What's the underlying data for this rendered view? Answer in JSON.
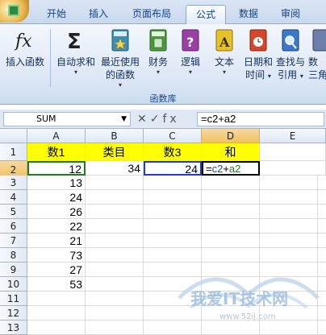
{
  "tabs": [
    "开始",
    "插入",
    "页面布局",
    "公式",
    "数据",
    "审阅"
  ],
  "ribbon": {
    "buttons": [
      {
        "label1": "插入函数",
        "label2": ""
      },
      {
        "label1": "自动求和",
        "label2": ""
      },
      {
        "label1": "最近使用",
        "label2": "的函数"
      },
      {
        "label1": "财务",
        "label2": ""
      },
      {
        "label1": "逻辑",
        "label2": ""
      },
      {
        "label1": "文本",
        "label2": ""
      },
      {
        "label1": "日期和",
        "label2": "时间"
      },
      {
        "label1": "查找与",
        "label2": "引用"
      },
      {
        "label1": "数",
        "label2": "三角"
      }
    ],
    "group_label": "函数库"
  },
  "formula_bar": {
    "name_box": "SUM",
    "tools": "✕✓fx",
    "formula": "=c2+a2"
  },
  "sheet": {
    "columns": [
      "A",
      "B",
      "C",
      "D",
      "E"
    ],
    "rows": [
      "1",
      "2",
      "3",
      "4",
      "5",
      "6",
      "7",
      "8",
      "9",
      "10",
      "11",
      "12",
      "13"
    ],
    "header_row": [
      "数1",
      "类目",
      "数3",
      "和"
    ],
    "a_values": [
      "12",
      "13",
      "24",
      "26",
      "22",
      "21",
      "73",
      "27",
      "53"
    ],
    "b2": "34",
    "c2": "24",
    "d2_formula": "=c2+a2"
  },
  "colors": {
    "header_fill": "#ffff00",
    "a2_ref": "#1a7f1a",
    "c2_ref": "#1f3fbf"
  }
}
